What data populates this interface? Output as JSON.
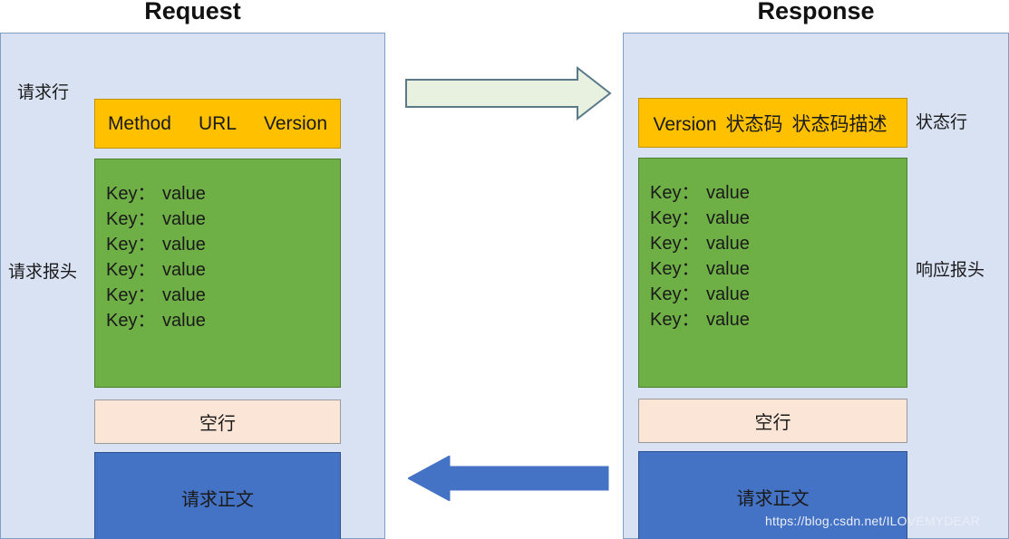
{
  "titles": {
    "request": "Request",
    "response": "Response"
  },
  "request": {
    "start_line": {
      "label": "请求行",
      "parts": [
        "Method",
        "URL",
        "Version"
      ]
    },
    "headers": {
      "label": "请求报头",
      "rows": [
        {
          "key": "Key：",
          "value": "value"
        },
        {
          "key": "Key：",
          "value": "value"
        },
        {
          "key": "Key：",
          "value": "value"
        },
        {
          "key": "Key：",
          "value": "value"
        },
        {
          "key": "Key：",
          "value": "value"
        },
        {
          "key": "Key：",
          "value": "value"
        }
      ]
    },
    "blank_line": {
      "text": "空行"
    },
    "body": {
      "text": "请求正文"
    }
  },
  "response": {
    "start_line": {
      "label": "状态行",
      "parts": [
        "Version",
        "状态码",
        "状态码描述"
      ]
    },
    "headers": {
      "label": "响应报头",
      "rows": [
        {
          "key": "Key：",
          "value": "value"
        },
        {
          "key": "Key：",
          "value": "value"
        },
        {
          "key": "Key：",
          "value": "value"
        },
        {
          "key": "Key：",
          "value": "value"
        },
        {
          "key": "Key：",
          "value": "value"
        },
        {
          "key": "Key：",
          "value": "value"
        }
      ]
    },
    "blank_line": {
      "text": "空行"
    },
    "body": {
      "text": "请求正文"
    }
  },
  "arrows": {
    "request_flow": {
      "direction": "right",
      "fill": "#e8f0e0",
      "stroke": "#5a7a8a"
    },
    "response_flow": {
      "direction": "left",
      "fill": "#4472c4",
      "stroke": "#4472c4"
    }
  },
  "colors": {
    "panel_bg": "#d9e2f3",
    "panel_border": "#7f9ec4",
    "start_line": "#ffc000",
    "headers": "#6eaf46",
    "blank_line": "#fbe5d6",
    "body": "#4472c4"
  },
  "watermark": {
    "text": "https://blog.csdn.net/ILOVEMYDEAR"
  }
}
